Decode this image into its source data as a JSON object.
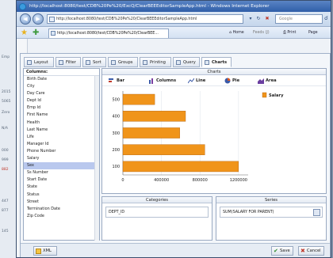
{
  "background_page": {
    "lines": [
      "Emp",
      "2015",
      "5065",
      "Zero",
      "N/A",
      "000",
      "999",
      "882",
      "447",
      "877",
      "145"
    ]
  },
  "browser": {
    "title": "http://localhost:8080/test/CDB%20Pe%20/ExcQ/ClearBEEEditorSampleApp.html - Windows Internet Explorer",
    "address": "http://localhost:8080/test/CDB%20Pe%20/ClearBEEEditorSampleApp.html",
    "search_placeholder": "Google",
    "tab_label": "http://localhost:8080/test/CDB%20Pe%20/ClearBEE...",
    "commands": {
      "home": "Home",
      "feeds": "Feeds (J)",
      "print": "Print",
      "page": "Page"
    },
    "colors": {
      "titlebar": "#2f5ea8",
      "accent": "#5a84c4"
    }
  },
  "dialog": {
    "tabs": [
      "Layout",
      "Filter",
      "Sort",
      "Groups",
      "Printing",
      "Query",
      "Charts"
    ],
    "active_tab": "Charts",
    "columns": {
      "header": "Columns:",
      "items": [
        "Birth Date",
        "City",
        "Day Care",
        "Dept Id",
        "Emp Id",
        "First Name",
        "Health",
        "Last Name",
        "Life",
        "Manager Id",
        "Phone Number",
        "Salary",
        "Sex",
        "Ss Number",
        "Start Date",
        "State",
        "Status",
        "Street",
        "Termination Date",
        "Zip Code"
      ],
      "selected": "Sex"
    },
    "charts_panel": {
      "header": "Charts",
      "types": [
        "Bar",
        "Columns",
        "Line",
        "Pie",
        "Area"
      ]
    },
    "categories": {
      "header": "Categories",
      "value": "DEPT_ID"
    },
    "series": {
      "header": "Series",
      "value": "SUM(SALARY FOR PARENT)"
    },
    "buttons": {
      "xml": "XML",
      "save": "Save",
      "cancel": "Cancel"
    },
    "colors": {
      "bar_fill": "#f0941a",
      "bar_stroke": "#b06010",
      "selected_row": "#b9c8ee"
    }
  },
  "chart_data": {
    "type": "bar",
    "orientation": "horizontal",
    "categories": [
      "500",
      "400",
      "300",
      "200",
      "100"
    ],
    "series": [
      {
        "name": "Salary",
        "values": [
          330000,
          650000,
          590000,
          850000,
          1200000
        ]
      }
    ],
    "xlim": [
      0,
      1300000
    ],
    "x_ticks": [
      "0",
      "400000",
      "800000",
      "1200000"
    ],
    "grid": true,
    "legend": "right"
  }
}
